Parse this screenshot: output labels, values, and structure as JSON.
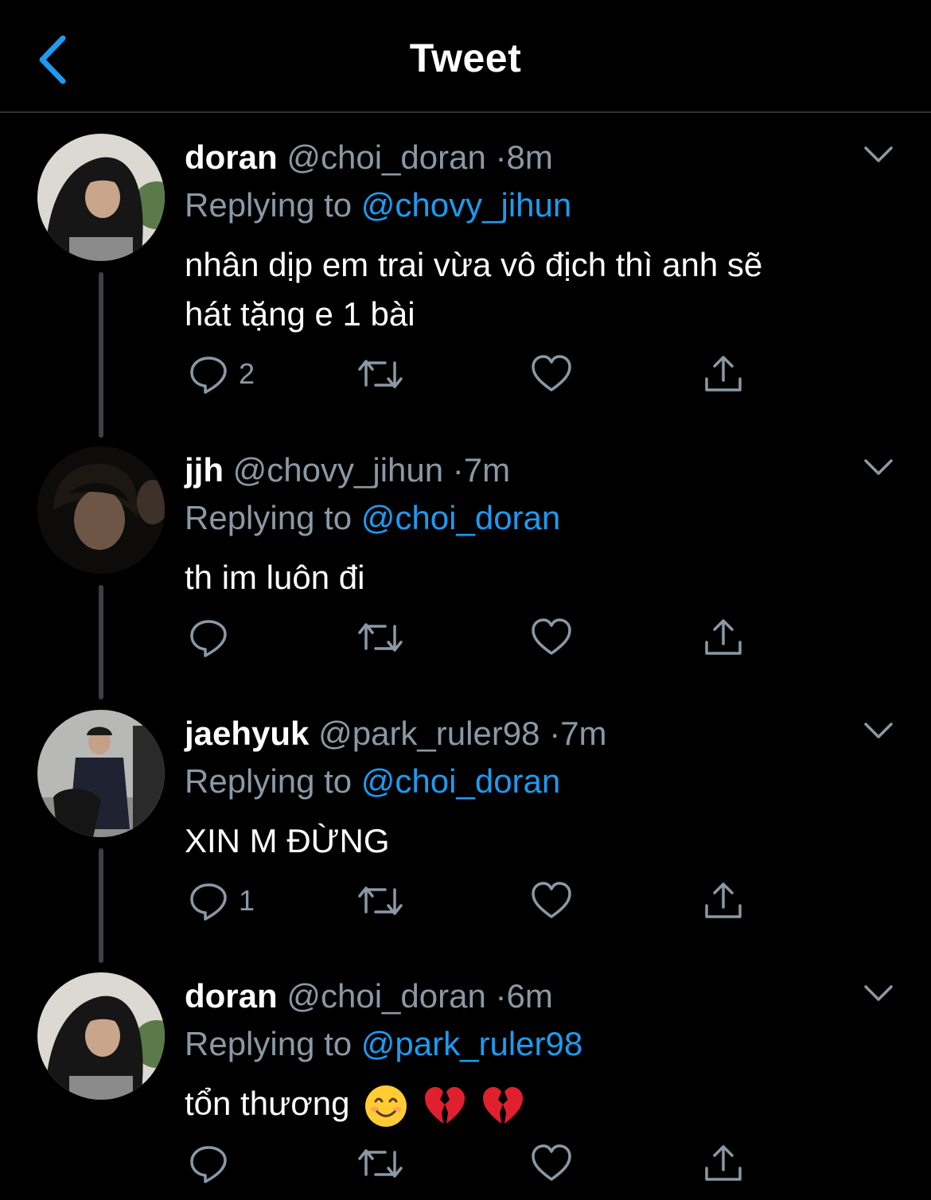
{
  "header": {
    "title": "Tweet"
  },
  "reply_prefix": "Replying to",
  "tweets": [
    {
      "name": "doran",
      "handle": "@choi_doran",
      "time": "8m",
      "reply_to": "@chovy_jihun",
      "text_lines": [
        "nhân dịp em trai vừa vô địch thì anh sẽ",
        "hát tặng e 1 bài"
      ],
      "reply_count": "2"
    },
    {
      "name": "jjh",
      "handle": "@chovy_jihun",
      "time": "7m",
      "reply_to": "@choi_doran",
      "text_lines": [
        "th im luôn đi"
      ],
      "reply_count": ""
    },
    {
      "name": "jaehyuk",
      "handle": "@park_ruler98",
      "time": "7m",
      "reply_to": "@choi_doran",
      "text_lines": [
        "XIN M ĐỪNG"
      ],
      "reply_count": "1"
    },
    {
      "name": "doran",
      "handle": "@choi_doran",
      "time": "6m",
      "reply_to": "@park_ruler98",
      "text_lines": [
        "tổn thương"
      ],
      "text_emojis": [
        "smiling-face-emoji",
        "broken-heart-emoji",
        "broken-heart-emoji"
      ],
      "reply_count": ""
    }
  ],
  "colors": {
    "accent": "#1d9bf0",
    "secondary": "#8b98a5",
    "background": "#000000"
  }
}
